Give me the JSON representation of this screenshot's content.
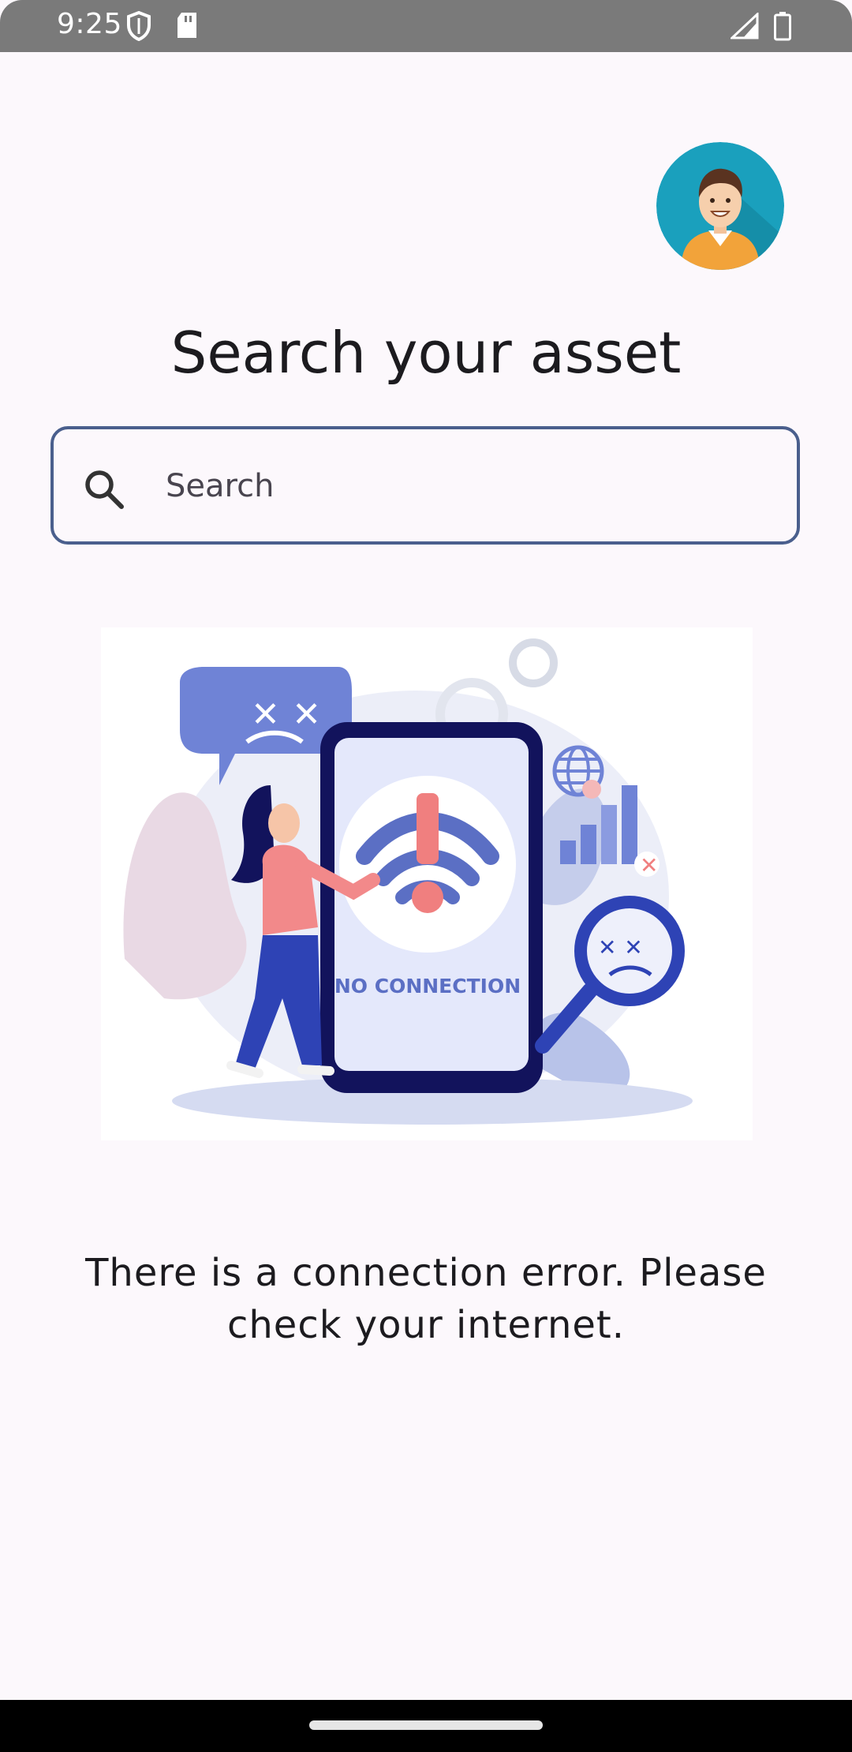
{
  "status_bar": {
    "time": "9:25",
    "icons": [
      "shield-icon",
      "sd-card-icon",
      "cellular-signal-icon",
      "battery-icon"
    ]
  },
  "header": {
    "avatar_icon": "user-avatar-icon"
  },
  "main": {
    "title": "Search your asset",
    "search": {
      "placeholder": "Search",
      "value": "",
      "icon": "search-icon"
    },
    "illustration": {
      "text": "NO CONNECTION",
      "icon": "no-connection-illustration"
    },
    "error_message": "There is a connection error. Please check your internet."
  },
  "colors": {
    "background": "#fcf8fc",
    "search_border": "#4a5f8d",
    "avatar_bg": "#1aa0bd",
    "illustration_accent": "#5b6fc4",
    "alert_red": "#f07f7f"
  }
}
